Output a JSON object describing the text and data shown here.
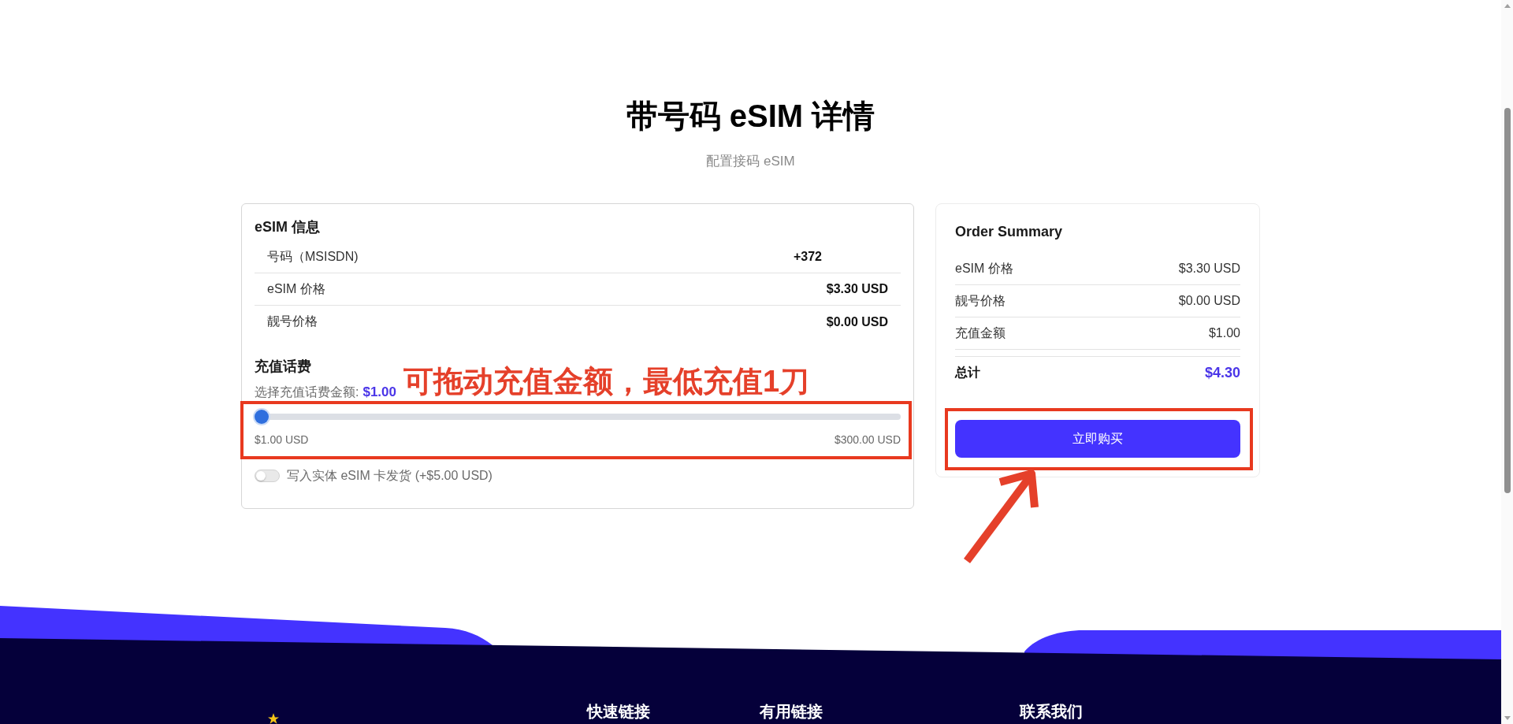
{
  "page": {
    "title": "带号码 eSIM 详情",
    "subtitle": "配置接码 eSIM"
  },
  "esim_info": {
    "title": "eSIM 信息",
    "rows": [
      {
        "kind": "number",
        "label": "号码（MSISDN)",
        "value": "+372"
      },
      {
        "kind": "price",
        "label": "eSIM 价格",
        "value": "$3.30 USD"
      },
      {
        "kind": "price",
        "label": "靓号价格",
        "value": "$0.00 USD"
      }
    ]
  },
  "recharge": {
    "title": "充值话费",
    "amount_label": "选择充值话费金额:",
    "amount": "$1.00",
    "slider": {
      "level": 0,
      "min_label": "$1.00 USD",
      "max_label": "$300.00 USD"
    },
    "shipping_toggle": {
      "label": "写入实体 eSIM 卡发货 (+$5.00 USD)",
      "checked": false
    }
  },
  "annotation": {
    "note": "可拖动充值金额，最低充值1刀"
  },
  "order_summary": {
    "title": "Order Summary",
    "rows": [
      {
        "label": "eSIM 价格",
        "value": "$3.30 USD"
      },
      {
        "label": "靓号价格",
        "value": "$0.00 USD"
      },
      {
        "label": "充值金额",
        "value": "$1.00"
      }
    ],
    "total": {
      "label": "总计",
      "value": "$4.30"
    },
    "button": "立即购买"
  },
  "footer": {
    "columns": [
      "快速链接",
      "有用链接",
      "联系我们"
    ]
  }
}
